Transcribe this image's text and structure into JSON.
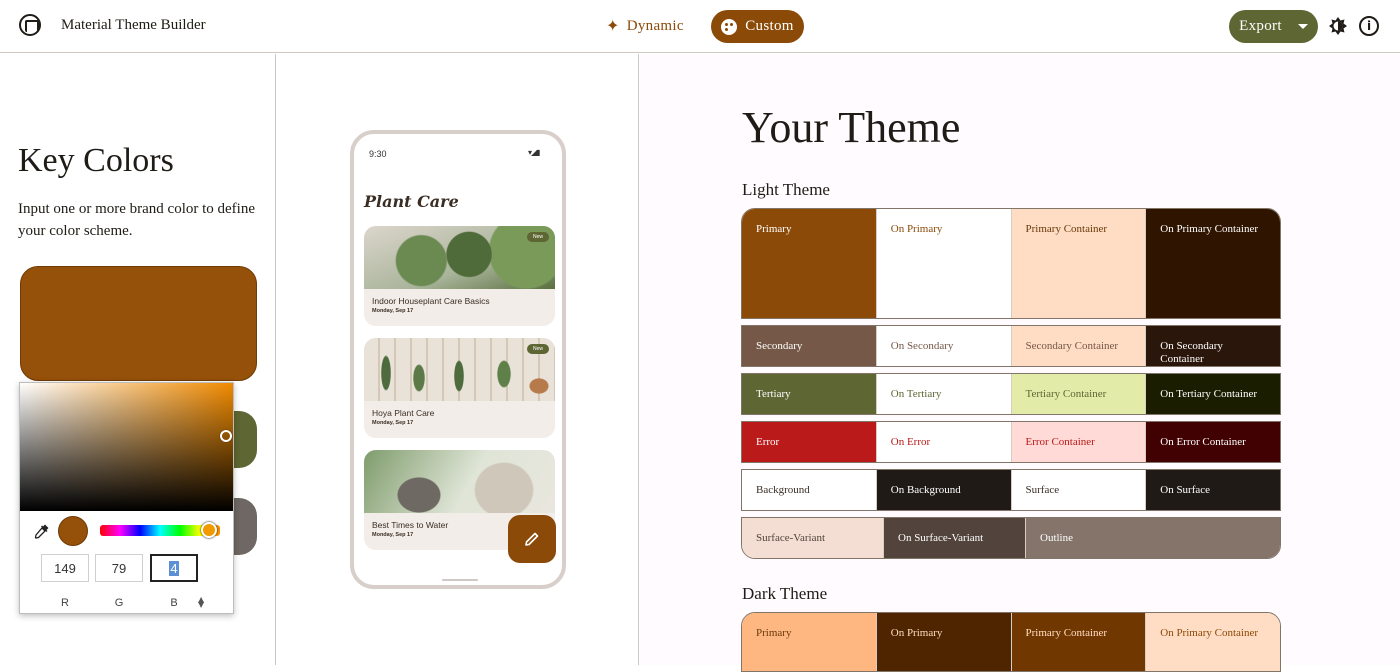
{
  "header": {
    "app_title": "Material Theme Builder",
    "mode_dynamic": "Dynamic",
    "mode_custom": "Custom",
    "export_label": "Export"
  },
  "key_colors": {
    "title": "Key Colors",
    "description": "Input one or more brand color to define your color scheme.",
    "primary_color": "#95500a",
    "secondary_color": "#5e6633",
    "tertiary_color": "#6e6763"
  },
  "color_picker": {
    "r": "149",
    "g": "79",
    "b": "4",
    "r_label": "R",
    "g_label": "G",
    "b_label": "B"
  },
  "preview": {
    "time": "9:30",
    "status_icons": "▾◢▮",
    "app_name": "Plant Care",
    "cards": [
      {
        "title": "Indoor Houseplant Care Basics",
        "date": "Monday, Sep 17",
        "badge": "New"
      },
      {
        "title": "Hoya Plant Care",
        "date": "Monday, Sep 17",
        "badge": "New"
      },
      {
        "title": "Best Times to Water",
        "date": "Monday, Sep 17",
        "badge": ""
      }
    ]
  },
  "theme": {
    "title": "Your Theme",
    "light_title": "Light Theme",
    "dark_title": "Dark Theme",
    "light_rows": [
      [
        {
          "label": "Primary",
          "bg": "#8b4a08",
          "fg": "#ffffff"
        },
        {
          "label": "On Primary",
          "bg": "#ffffff",
          "fg": "#8b4a08"
        },
        {
          "label": "Primary Container",
          "bg": "#ffdcc4",
          "fg": "#6a3a0a"
        },
        {
          "label": "On Primary Container",
          "bg": "#2f1400",
          "fg": "#ffffff"
        }
      ],
      [
        {
          "label": "Secondary",
          "bg": "#755847",
          "fg": "#ffffff"
        },
        {
          "label": "On Secondary",
          "bg": "#ffffff",
          "fg": "#755847"
        },
        {
          "label": "Secondary Container",
          "bg": "#ffdcc4",
          "fg": "#755847"
        },
        {
          "label": "On Secondary Container",
          "bg": "#2b160b",
          "fg": "#ffffff"
        }
      ],
      [
        {
          "label": "Tertiary",
          "bg": "#5e6633",
          "fg": "#ffffff"
        },
        {
          "label": "On Tertiary",
          "bg": "#ffffff",
          "fg": "#5e6633"
        },
        {
          "label": "Tertiary Container",
          "bg": "#e3eba8",
          "fg": "#5e6633"
        },
        {
          "label": "On Tertiary Container",
          "bg": "#1b1d00",
          "fg": "#ffffff"
        }
      ],
      [
        {
          "label": "Error",
          "bg": "#ba1a1a",
          "fg": "#ffffff"
        },
        {
          "label": "On Error",
          "bg": "#ffffff",
          "fg": "#ba1a1a"
        },
        {
          "label": "Error Container",
          "bg": "#ffdad6",
          "fg": "#ba1a1a"
        },
        {
          "label": "On Error Container",
          "bg": "#410002",
          "fg": "#ffffff"
        }
      ],
      [
        {
          "label": "Background",
          "bg": "#ffffff",
          "fg": "#3a2d24"
        },
        {
          "label": "On Background",
          "bg": "#201a17",
          "fg": "#ffffff"
        },
        {
          "label": "Surface",
          "bg": "#ffffff",
          "fg": "#3a2d24"
        },
        {
          "label": "On Surface",
          "bg": "#201a17",
          "fg": "#ffffff"
        }
      ]
    ],
    "light_last_row": [
      {
        "label": "Surface-Variant",
        "bg": "#f4ded3",
        "fg": "#52443c"
      },
      {
        "label": "On Surface-Variant",
        "bg": "#52443c",
        "fg": "#ffffff"
      },
      {
        "label": "Outline",
        "bg": "#84746a",
        "fg": "#ffffff"
      }
    ],
    "dark_rows": [
      [
        {
          "label": "Primary",
          "bg": "#ffb782",
          "fg": "#6a3a0a"
        },
        {
          "label": "On Primary",
          "bg": "#4f2500",
          "fg": "#ffdcc4"
        },
        {
          "label": "Primary Container",
          "bg": "#703700",
          "fg": "#ffdcc4"
        },
        {
          "label": "On Primary Container",
          "bg": "#ffdcc4",
          "fg": "#8b4a08"
        }
      ]
    ]
  }
}
